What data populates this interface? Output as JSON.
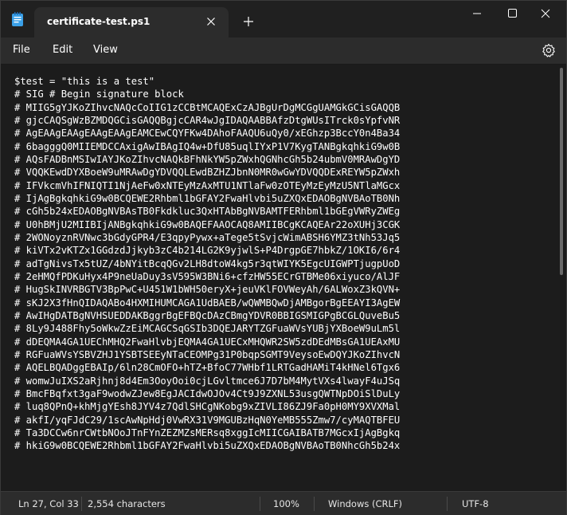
{
  "app": {
    "tab_title": "certificate-test.ps1",
    "icons": {
      "app": "notepad-icon",
      "tab_close": "close-icon",
      "new_tab": "plus-icon",
      "minimize": "minimize-icon",
      "maximize": "maximize-icon",
      "close": "close-icon",
      "settings": "gear-icon"
    },
    "accent": "#4cc2ff"
  },
  "menu": {
    "file": "File",
    "edit": "Edit",
    "view": "View"
  },
  "editor": {
    "lines": [
      "$test = \"this is a test\"",
      "# SIG # Begin signature block",
      "# MIIG5gYJKoZIhvcNAQcCoIIG1zCCBtMCAQExCzAJBgUrDgMCGgUAMGkGCisGAQQB",
      "# gjcCAQSgWzBZMDQGCisGAQQBgjcCAR4wJgIDAQAABBAfzDtgWUsITrck0sYpfvNR",
      "# AgEAAgEAAgEAAgEAAgEAMCEwCQYFKw4DAhoFAAQU6uQy0/xEGhzp3BccY0n4Ba34",
      "# 6bagggQ0MIIEMDCCAxigAwIBAgIQ4w+DfU85uqlIYxP1V7KygTANBgkqhkiG9w0B",
      "# AQsFADBnMSIwIAYJKoZIhvcNAQkBFhNkYW5pZWxhQGNhcGh5b24ubmV0MRAwDgYD",
      "# VQQKEwdDYXBoeW9uMRAwDgYDVQQLEwdBZHZJbnN0MR0wGwYDVQQDExREYW5pZWxh",
      "# IFVkcmVhIFNIQTI1NjAeFw0xNTEyMzAxMTU1NTlaFw0zOTEyMzEyMzU5NTlaMGcx",
      "# IjAgBgkqhkiG9w0BCQEWE2Rhbml1bGFAY2FwaHlvbi5uZXQxEDAOBgNVBAoTB0Nh",
      "# cGh5b24xEDAOBgNVBAsTB0Fkdkluc3QxHTAbBgNVBAMTFERhbml1bGEgVWRyZWEg",
      "# U0hBMjU2MIIBIjANBgkqhkiG9w0BAQEFAAOCAQ8AMIIBCgKCAQEAr22oXUHj3CGK",
      "# 2WONoyznRVNwc3bGdyGPR4/E3qpyPywx+aTege5tSvjcWimABSH6YMZ3tNh53Jq5",
      "# kiVTx2vKTZx1GGdzdJjkyb3zC4b214LG2K9yjwlS+P4DrgpGE7hbkZ/1OKI6/6r4",
      "# adTgNivsTx5tUZ/4bNYitBcqQGv2LH8dtoW4kg5r3qtWIYK5EgcUIGWPTjugpUoD",
      "# 2eHMQfPDKuHyx4P9neUaDuy3sV595W3BNi6+cfzHW55ECrGTBMe06xiyuco/AlJF",
      "# HugSkINVRBGTV3BpPwC+U451W1bWH50eryX+jeuVKlFOVWeyAh/6ALWoxZ3kQVN+",
      "# sKJ2X3fHnQIDAQABo4HXMIHUMCAGA1UdBAEB/wQWMBQwDjAMBgorBgEEAYI3AgEW",
      "# AwIHgDATBgNVHSUEDDAKBggrBgEFBQcDAzCBmgYDVR0BBIGSMIGPgBCGLQuveBu5",
      "# 8Ly9J488Fhy5oWkwZzEiMCAGCSqGSIb3DQEJARYTZGFuaWVsYUBjYXBoeW9uLm5l",
      "# dDEQMA4GA1UEChMHQ2FwaHlvbjEQMA4GA1UECxMHQWR2SW5zdDEdMBsGA1UEAxMU",
      "# RGFuaWVsYSBVZHJ1YSBTSEEyNTaCEOMPg31P0bqpSGMT9VeysoEwDQYJKoZIhvcN",
      "# AQELBQADggEBAIp/6ln28CmOFO+hTZ+BfoC77WHbf1LRTGadHAMiT4kHNel6Tgx6",
      "# womwJuIXS2aRjhnj8d4Em3OoyOoi0cjLGvltmce6J7D7bM4MytVXs4lwayF4uJSq",
      "# BmcFBqfxt3gaF9wodwZJew8EgJACIdwOJOv4Ct9J9ZXNL53usgQWTNpDOiSlDuLy",
      "# luq8QPnQ+khMjgYEsh8JYV4z7QdlSHCgNKobg9xZIVLI86ZJ9Fa0pH0MY9XVXMal",
      "# akfI/yqFJdC29/1scAwNpHdj0VwRX31V9MGUBzHqN0YeMB555Zmw7/cyMAQTBFEU",
      "# Ta3DCCw6nrCWtbNOoJTnFYnZEZMZsMERsq8xggIcMIICGAIBATB7MGcxIjAgBgkq",
      "# hkiG9w0BCQEWE2Rhbml1bGFAY2FwaHlvbi5uZXQxEDAOBgNVBAoTB0NhcGh5b24x"
    ]
  },
  "status": {
    "position": "Ln 27, Col 33",
    "characters": "2,554 characters",
    "zoom": "100%",
    "line_ending": "Windows (CRLF)",
    "encoding": "UTF-8"
  }
}
